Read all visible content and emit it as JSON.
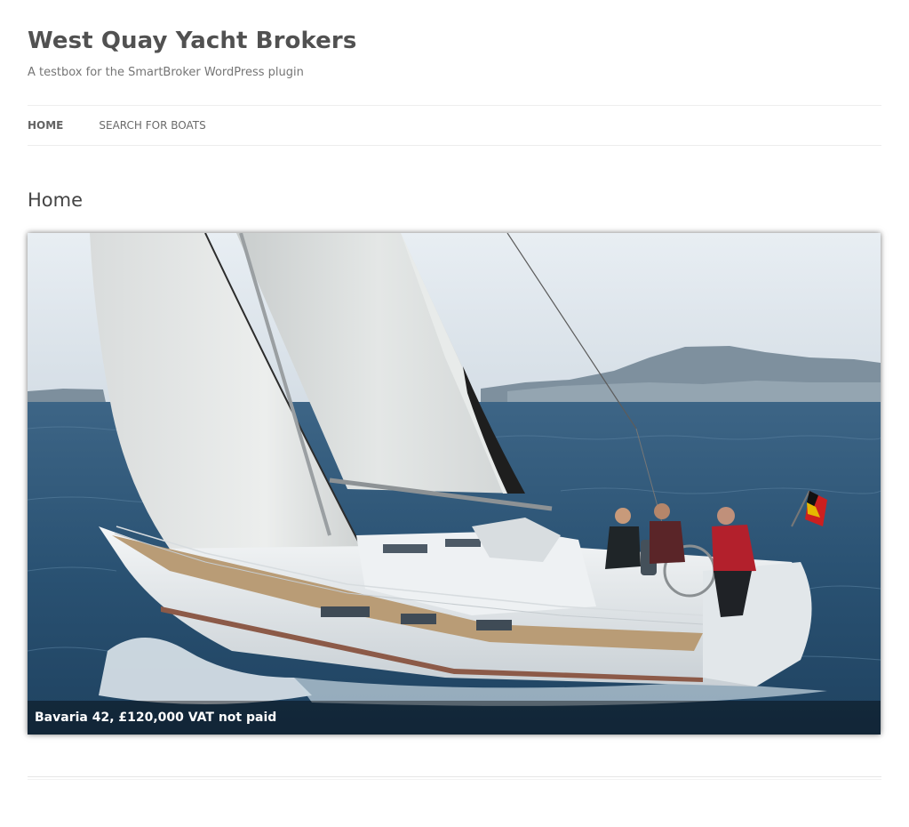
{
  "site": {
    "title": "West Quay Yacht Brokers",
    "tagline": "A testbox for the SmartBroker WordPress plugin"
  },
  "nav": {
    "items": [
      {
        "label": "HOME",
        "current": true
      },
      {
        "label": "SEARCH FOR BOATS",
        "current": false
      }
    ]
  },
  "page": {
    "title": "Home"
  },
  "slider": {
    "image": "sailing-yacht-photo",
    "caption": "Bavaria 42, £120,000 VAT not paid"
  },
  "colors": {
    "title": "#515151",
    "tagline": "#757575",
    "nav_text": "#6a6a6a",
    "sea": "#2b5476",
    "sky": "#dfe7ee",
    "caption_bg": "rgba(0,0,0,0.42)"
  }
}
